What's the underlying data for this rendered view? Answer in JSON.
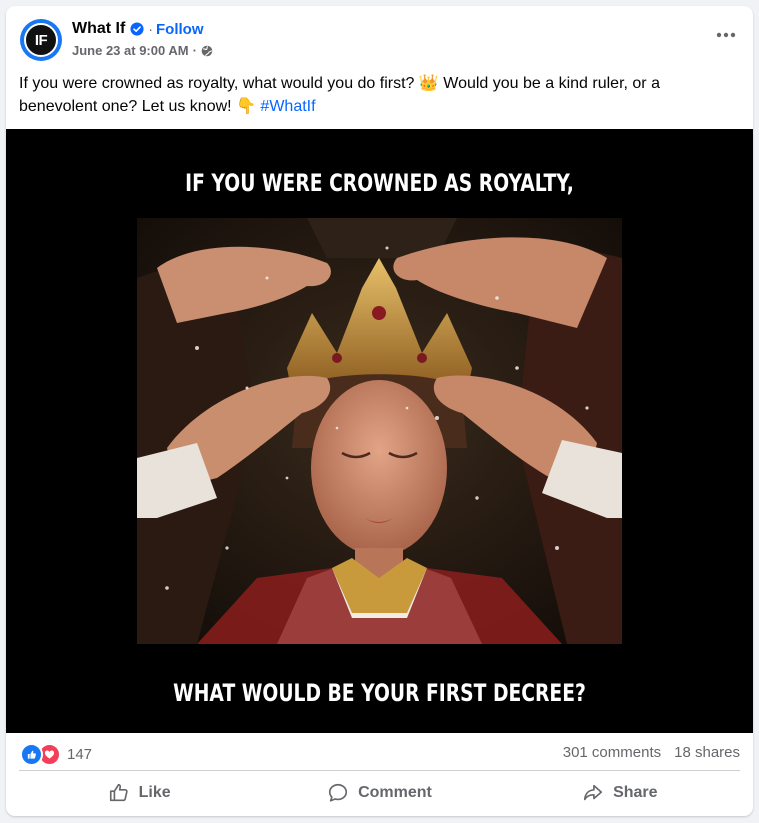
{
  "post": {
    "page_name": "What If",
    "avatar_text": "IF",
    "follow_label": "Follow",
    "separator": "·",
    "timestamp": "June 23 at 9:00 AM",
    "caption_text": "If you were crowned as royalty, what would you do first? 👑 Would you be a kind ruler, or a benevolent one? Let us know! 👇",
    "hashtag": "#WhatIf"
  },
  "image": {
    "top_text": "IF YOU WERE CROWNED AS ROYALTY,",
    "bottom_text": "WHAT WOULD BE YOUR FIRST DECREE?"
  },
  "stats": {
    "reaction_count": "147",
    "comments": "301 comments",
    "shares": "18 shares"
  },
  "actions": {
    "like": "Like",
    "comment": "Comment",
    "share": "Share"
  },
  "icons": {
    "verified": "verified-badge-icon",
    "audience": "globe-icon",
    "more": "more-options-icon",
    "like": "thumbs-up-icon",
    "comment": "speech-bubble-icon",
    "share": "share-arrow-icon"
  },
  "colors": {
    "accent": "#0866ff",
    "like_reaction": "#1877f2",
    "love_reaction": "#f33e58",
    "muted_text": "#65676b"
  }
}
